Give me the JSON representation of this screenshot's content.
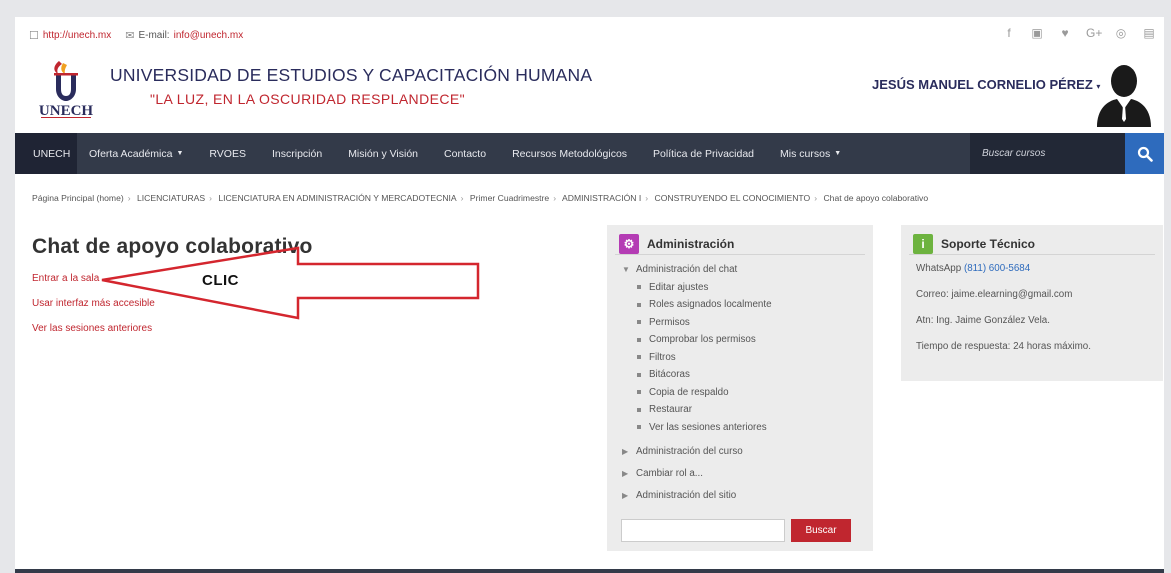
{
  "topbar": {
    "url": "http://unech.mx",
    "email_label": "E-mail:",
    "email": "info@unech.mx",
    "social_icons": [
      "facebook-icon",
      "flickr-icon",
      "twitter-icon",
      "google-plus-icon",
      "instagram-icon",
      "youtube-icon"
    ]
  },
  "header": {
    "logo_text": "UNECH",
    "university_name": "UNIVERSIDAD DE ESTUDIOS Y CAPACITACIÓN HUMANA",
    "motto": "\"LA LUZ, EN LA OSCURIDAD RESPLANDECE\"",
    "user_name": "JESÚS MANUEL CORNELIO PÉREZ",
    "user_caret": "▾"
  },
  "nav": {
    "brand": "UNECH",
    "items": [
      {
        "label": "Oferta Académica",
        "dropdown": true
      },
      {
        "label": "RVOES"
      },
      {
        "label": "Inscripción"
      },
      {
        "label": "Misión y Visión"
      },
      {
        "label": "Contacto"
      },
      {
        "label": "Recursos Metodológicos"
      },
      {
        "label": "Política de Privacidad"
      },
      {
        "label": "Mis cursos",
        "dropdown": true
      }
    ],
    "search_placeholder": "Buscar cursos"
  },
  "breadcrumb": [
    "Página Principal (home)",
    "LICENCIATURAS",
    "LICENCIATURA EN ADMINISTRACIÓN Y MERCADOTECNIA",
    "Primer Cuadrimestre",
    "ADMINISTRACIÓN I",
    "CONSTRUYENDO EL CONOCIMIENTO",
    "Chat de apoyo colaborativo"
  ],
  "main": {
    "title": "Chat de apoyo colaborativo",
    "links": [
      "Entrar a la sala",
      "Usar interfaz más accesible",
      "Ver las sesiones anteriores"
    ],
    "annotation": "CLIC"
  },
  "admin": {
    "title": "Administración",
    "chat_admin": "Administración del chat",
    "chat_items": [
      "Editar ajustes",
      "Roles asignados localmente",
      "Permisos",
      "Comprobar los permisos",
      "Filtros",
      "Bitácoras",
      "Copia de respaldo",
      "Restaurar",
      "Ver las sesiones anteriores"
    ],
    "other_nodes": [
      "Administración del curso",
      "Cambiar rol a...",
      "Administración del sitio"
    ],
    "search_button": "Buscar"
  },
  "support": {
    "title": "Soporte Técnico",
    "whatsapp_label": "WhatsApp",
    "whatsapp_number": "(811) 600-5684",
    "email_line": "Correo: jaime.elearning@gmail.com",
    "contact_line": "Atn: Ing. Jaime González Vela.",
    "response_line": "Tiempo de respuesta: 24 horas máximo."
  },
  "colors": {
    "accent_red": "#c0262f",
    "navy": "#2a2c5c",
    "nav_bg": "#333a49",
    "admin_icon": "#b43cb4",
    "support_icon": "#6db33f",
    "link_blue": "#2e6bbd"
  }
}
